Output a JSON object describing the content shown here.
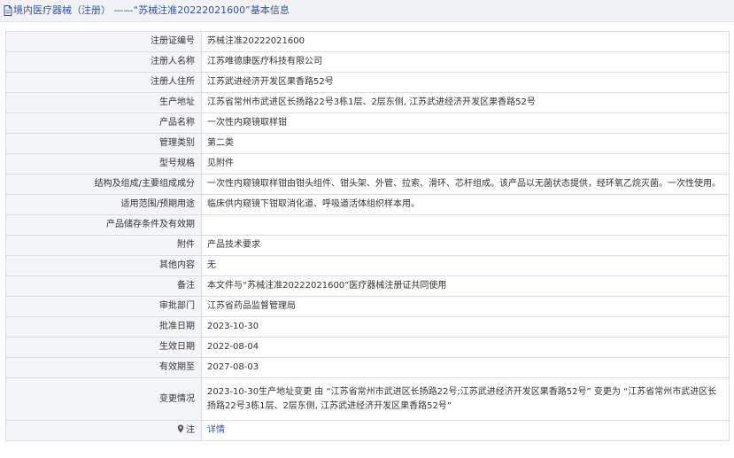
{
  "header": {
    "title": "境内医疗器械（注册） ——“苏械注准20222021600”基本信息"
  },
  "rows": [
    {
      "label": "注册证编号",
      "value": "苏械注准20222021600"
    },
    {
      "label": "注册人名称",
      "value": "江苏唯德康医疗科技有限公司"
    },
    {
      "label": "注册人住所",
      "value": "江苏武进经济开发区果香路52号"
    },
    {
      "label": "生产地址",
      "value": "江苏省常州市武进区长扬路22号3栋1层、2层东侧, 江苏武进经济开发区果香路52号"
    },
    {
      "label": "产品名称",
      "value": "一次性内窥镜取样钳"
    },
    {
      "label": "管理类别",
      "value": "第二类"
    },
    {
      "label": "型号规格",
      "value": "见附件"
    },
    {
      "label": "结构及组成/主要组成成分",
      "value": "一次性内窥镜取样钳由钳头组件、钳头架、外管、拉索、滑环、芯杆组成。该产品以无菌状态提供，经环氧乙烷灭菌。一次性使用。"
    },
    {
      "label": "适用范围/预期用途",
      "value": "临床供内窥镜下钳取消化道、呼吸道活体组织样本用。"
    },
    {
      "label": "产品储存条件及有效期",
      "value": ""
    },
    {
      "label": "附件",
      "value": "产品技术要求"
    },
    {
      "label": "其他内容",
      "value": "无"
    },
    {
      "label": "备注",
      "value": "本文件与“苏械注准20222021600”医疗器械注册证共同使用"
    },
    {
      "label": "审批部门",
      "value": "江苏省药品监督管理局"
    },
    {
      "label": "批准日期",
      "value": "2023-10-30"
    },
    {
      "label": "生效日期",
      "value": "2022-08-04"
    },
    {
      "label": "有效期至",
      "value": "2027-08-03"
    },
    {
      "label": "变更情况",
      "value": "2023-10-30生产地址变更 由 “江苏省常州市武进区长扬路22号;江苏武进经济开发区果香路52号” 变更为 “江苏省常州市武进区长扬路22号3栋1层、2层东侧, 江苏武进经济开发区果香路52号”"
    }
  ],
  "footer_row": {
    "label": "注",
    "link": "详情",
    "icon": "location-pin-icon"
  },
  "colors": {
    "title": "#2f56a5",
    "label_bg": "#f4f5f9",
    "border": "#d8dce6",
    "link": "#2f56a5"
  }
}
